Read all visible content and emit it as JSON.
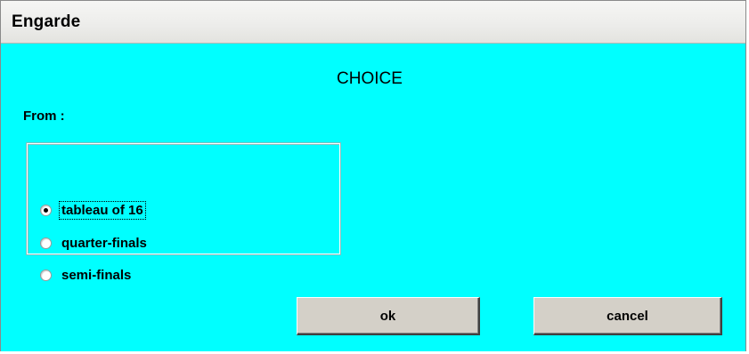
{
  "window": {
    "title": "Engarde"
  },
  "dialog": {
    "heading": "CHOICE",
    "from_label": "From :",
    "options": [
      {
        "label": "tableau of 16",
        "selected": true
      },
      {
        "label": "quarter-finals",
        "selected": false
      },
      {
        "label": "semi-finals",
        "selected": false
      }
    ],
    "ok_label": "ok",
    "cancel_label": "cancel"
  },
  "colors": {
    "background": "#00ffff",
    "button_face": "#d4d0c8",
    "titlebar": "#ececea"
  }
}
